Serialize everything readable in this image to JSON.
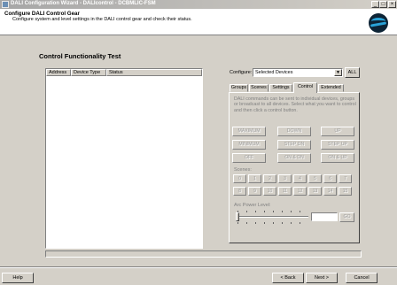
{
  "window": {
    "title": "DALI Configuration Wizard - DALIcontrol - DCBMLIC-FSM",
    "minimize_glyph": "_",
    "maximize_glyph": "□",
    "close_glyph": "×"
  },
  "header": {
    "title": "Configure DALI Control Gear",
    "subtitle": "Configure system and level settings in the DALI control gear and check their status."
  },
  "panel": {
    "title": "Control Functionality Test",
    "columns": [
      "Address",
      "Device Type",
      "Status"
    ]
  },
  "configure": {
    "label": "Configure:",
    "selected": "Selected Devices",
    "all_button": "ALL"
  },
  "tabs": [
    {
      "label": "Groups",
      "active": false
    },
    {
      "label": "Scenes",
      "active": false
    },
    {
      "label": "Settings",
      "active": false
    },
    {
      "label": "Control",
      "active": true
    },
    {
      "label": "Extended",
      "active": false
    }
  ],
  "control": {
    "instructions": "DALI commands can be sent to individual devices, groups or broadcast to all devices. Select what you want to control and then click a control button.",
    "buttons": [
      "MAXIMUM",
      "DOWN",
      "UP",
      "MINIMUM",
      "STEP DN",
      "STEP UP",
      "OFF",
      "ON & DN",
      "ON & UP"
    ],
    "scenes_label": "Scenes:",
    "scenes": [
      "0",
      "1",
      "2",
      "3",
      "4",
      "5",
      "6",
      "7",
      "8",
      "9",
      "10",
      "11",
      "12",
      "13",
      "14",
      "15"
    ],
    "arc_label": "Arc Power Level:",
    "go_button": "GO"
  },
  "footer": {
    "help": "Help",
    "back": "< Back",
    "next": "Next >",
    "cancel": "Cancel"
  },
  "colors": {
    "dialog_bg": "#d4d0c8",
    "logo_dark": "#0d2436",
    "logo_accent": "#2aa3d8"
  }
}
